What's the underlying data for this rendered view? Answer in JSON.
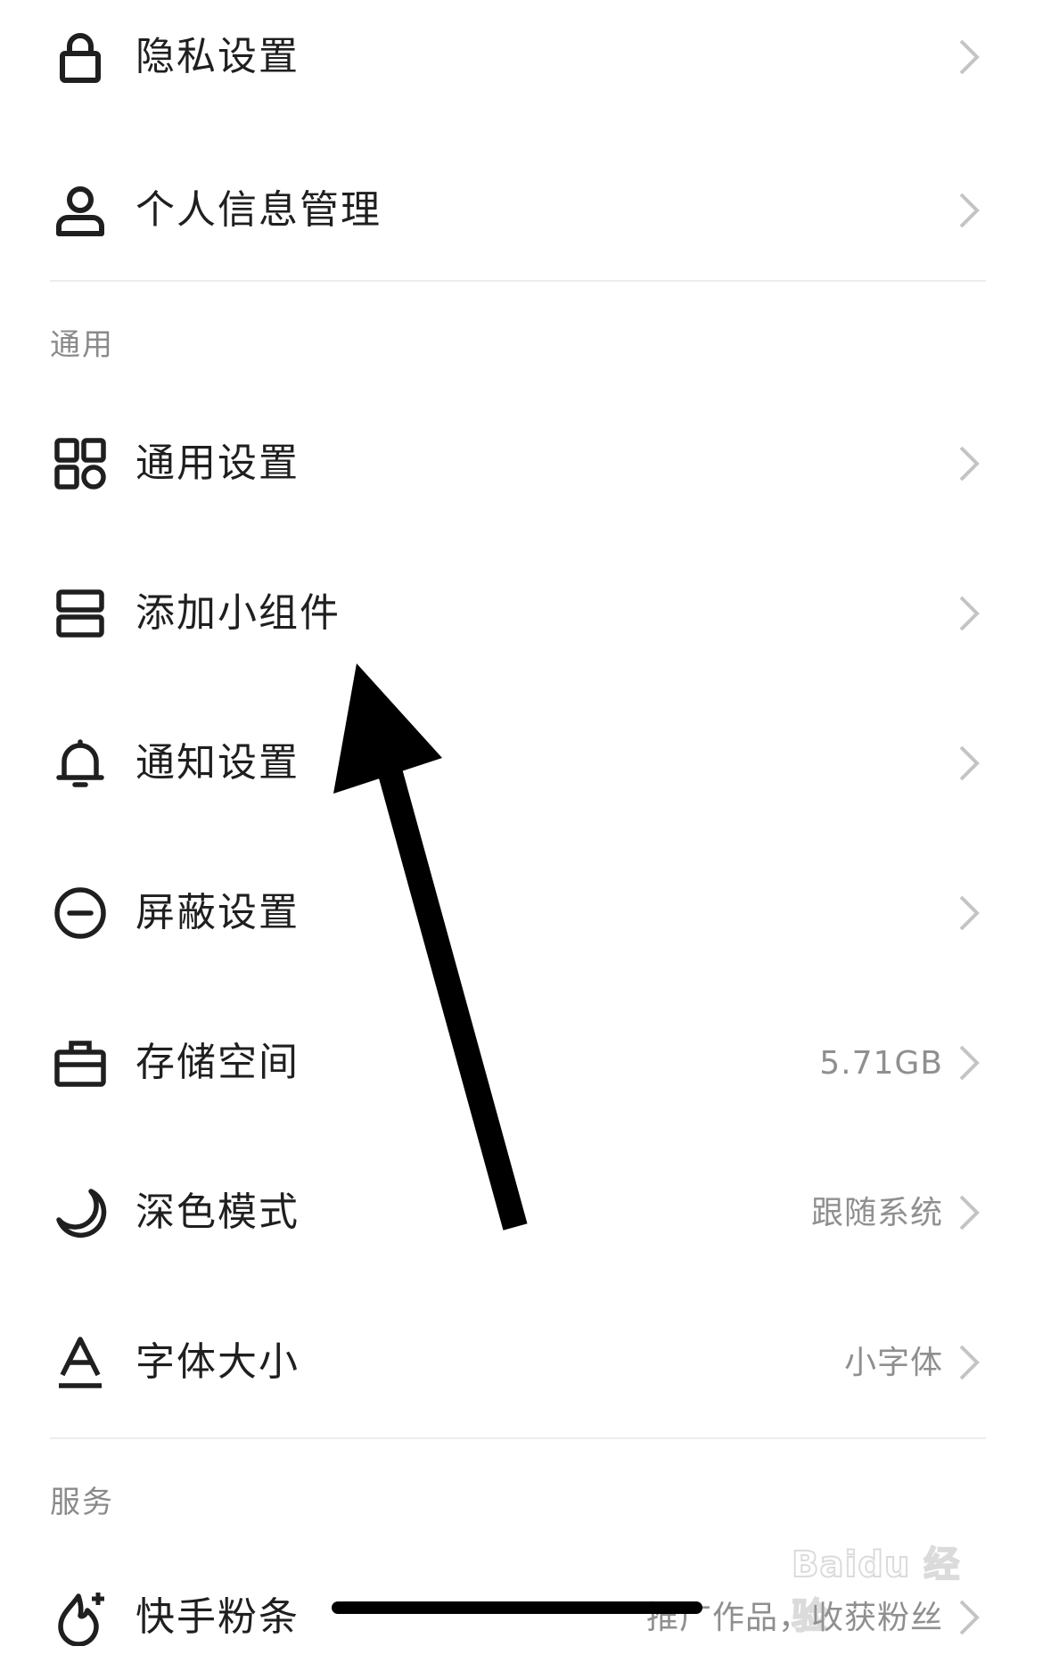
{
  "rows_top": [
    {
      "label": "隐私设置",
      "icon": "lock-icon",
      "value": ""
    },
    {
      "label": "个人信息管理",
      "icon": "person-icon",
      "value": ""
    }
  ],
  "sections": [
    {
      "header": "通用",
      "items": [
        {
          "label": "通用设置",
          "icon": "grid-icon",
          "value": ""
        },
        {
          "label": "添加小组件",
          "icon": "widget-icon",
          "value": ""
        },
        {
          "label": "通知设置",
          "icon": "bell-icon",
          "value": ""
        },
        {
          "label": "屏蔽设置",
          "icon": "block-icon",
          "value": ""
        },
        {
          "label": "存储空间",
          "icon": "storage-icon",
          "value": "5.71GB"
        },
        {
          "label": "深色模式",
          "icon": "moon-icon",
          "value": "跟随系统"
        },
        {
          "label": "字体大小",
          "icon": "font-size-icon",
          "value": "小字体"
        }
      ]
    },
    {
      "header": "服务",
      "items": [
        {
          "label": "快手粉条",
          "icon": "flame-plus-icon",
          "value": "推广作品，收获粉丝"
        }
      ]
    }
  ],
  "watermark": "Baidu 经验",
  "colors": {
    "text": "#1f1f1f",
    "secondary": "#8f8f8f",
    "divider": "#ececec",
    "chevron": "#c4c4c4",
    "arrow": "#000000"
  }
}
